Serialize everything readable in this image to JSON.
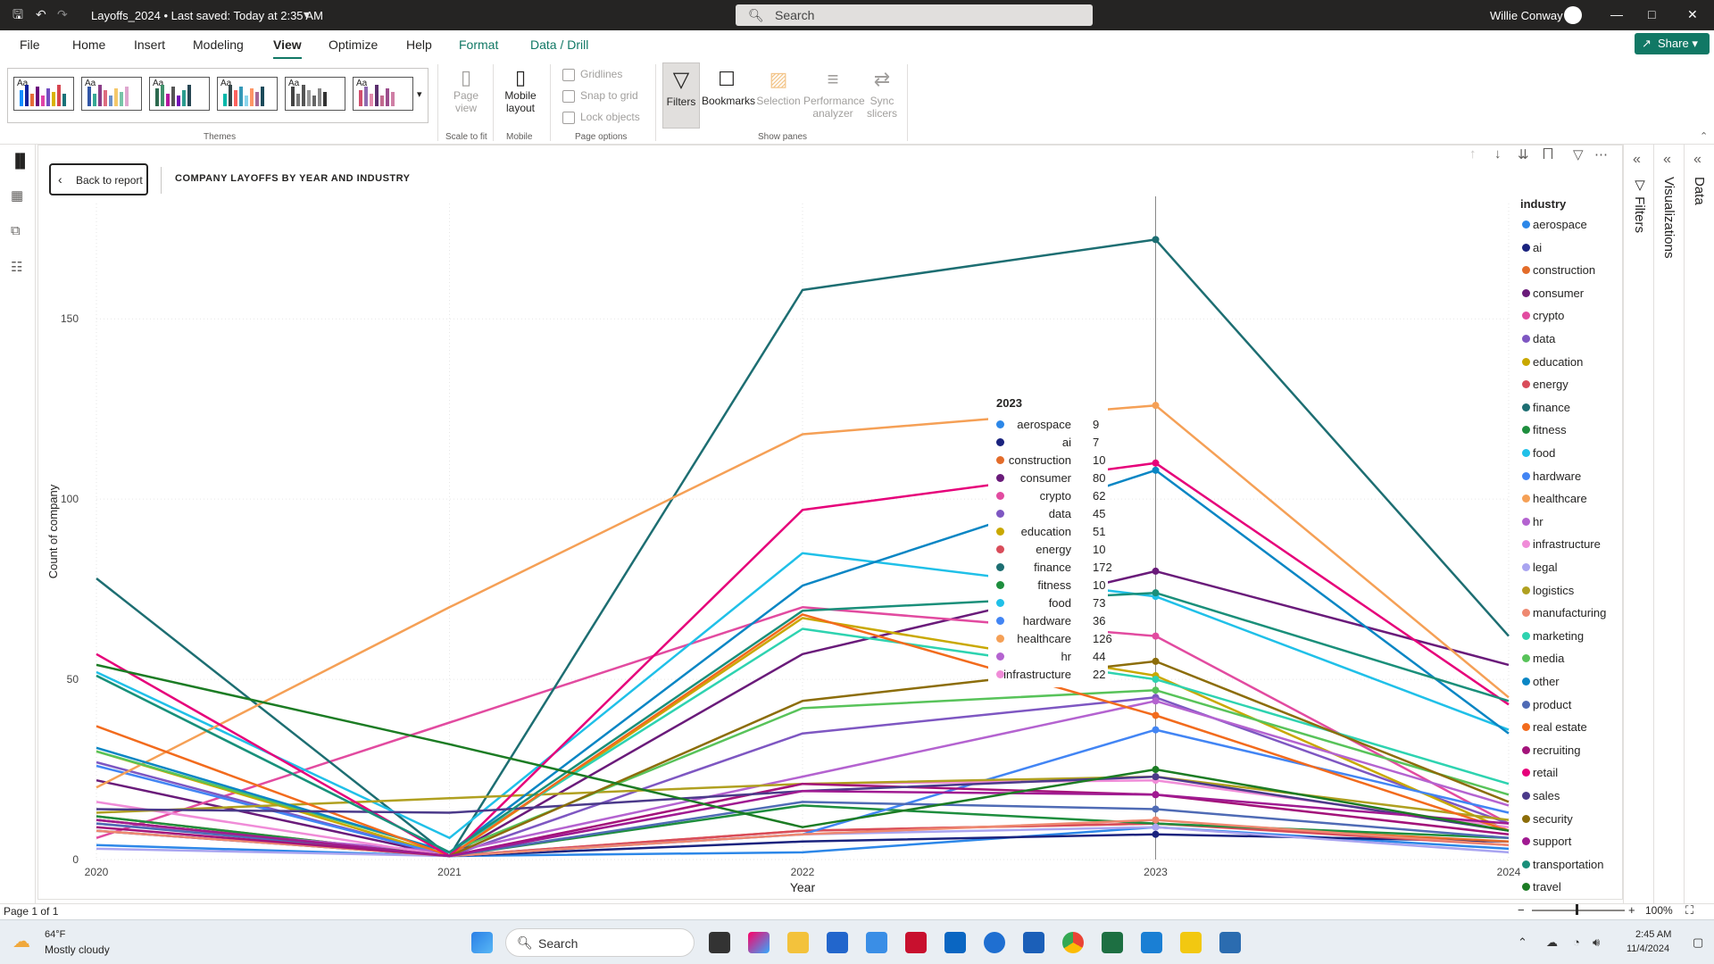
{
  "window": {
    "doc_title": "Layoffs_2024 • Last saved: Today at 2:35 AM",
    "search_placeholder": "Search",
    "user": "Willie Conway"
  },
  "menu": [
    "File",
    "Home",
    "Insert",
    "Modeling",
    "View",
    "Optimize",
    "Help",
    "Format",
    "Data / Drill"
  ],
  "active_menu": "View",
  "share_label": "Share",
  "ribbon": {
    "themes_label": "Themes",
    "page_view": "Page view",
    "scale_label": "Scale to fit",
    "mobile_layout": "Mobile layout",
    "mobile_label": "Mobile",
    "gridlines": "Gridlines",
    "snap": "Snap to grid",
    "lock": "Lock objects",
    "page_options_label": "Page options",
    "filters": "Filters",
    "bookmarks": "Bookmarks",
    "selection": "Selection",
    "performance": "Performance analyzer",
    "sync": "Sync slicers",
    "show_panes_label": "Show panes",
    "theme_aa": "Aa"
  },
  "report": {
    "back_label": "Back to report",
    "chart_title": "COMPANY LAYOFFS BY YEAR AND INDUSTRY",
    "legend_title": "industry"
  },
  "panes": {
    "filters": "Filters",
    "visualizations": "Visualizations",
    "data": "Data"
  },
  "status": {
    "page": "Page 1 of 1",
    "zoom": "100%"
  },
  "taskbar": {
    "temp": "64°F",
    "weather": "Mostly cloudy",
    "search": "Search",
    "time": "2:45 AM",
    "date": "11/4/2024"
  },
  "tooltip": {
    "title": "2023",
    "rows": [
      {
        "cat": "aerospace",
        "val": "9"
      },
      {
        "cat": "ai",
        "val": "7"
      },
      {
        "cat": "construction",
        "val": "10"
      },
      {
        "cat": "consumer",
        "val": "80"
      },
      {
        "cat": "crypto",
        "val": "62"
      },
      {
        "cat": "data",
        "val": "45"
      },
      {
        "cat": "education",
        "val": "51"
      },
      {
        "cat": "energy",
        "val": "10"
      },
      {
        "cat": "finance",
        "val": "172"
      },
      {
        "cat": "fitness",
        "val": "10"
      },
      {
        "cat": "food",
        "val": "73"
      },
      {
        "cat": "hardware",
        "val": "36"
      },
      {
        "cat": "healthcare",
        "val": "126"
      },
      {
        "cat": "hr",
        "val": "44"
      },
      {
        "cat": "infrastructure",
        "val": "22"
      }
    ]
  },
  "chart_data": {
    "type": "line",
    "title": "COMPANY LAYOFFS BY YEAR AND INDUSTRY",
    "xlabel": "Year",
    "ylabel": "Count of company",
    "x": [
      2020,
      2021,
      2022,
      2023,
      2024
    ],
    "yticks": [
      0,
      50,
      100,
      150
    ],
    "ylim": [
      0,
      182
    ],
    "legend_title": "industry",
    "legend_position": "right",
    "grid": true,
    "series": [
      {
        "name": "aerospace",
        "color": "#2C87E8",
        "values": [
          4,
          1,
          2,
          9,
          3
        ]
      },
      {
        "name": "ai",
        "color": "#1A237E",
        "values": [
          8,
          1,
          5,
          7,
          5
        ]
      },
      {
        "name": "construction",
        "color": "#E36C2A",
        "values": [
          12,
          1,
          8,
          10,
          5
        ]
      },
      {
        "name": "consumer",
        "color": "#6A1B7A",
        "values": [
          22,
          1,
          57,
          80,
          54
        ]
      },
      {
        "name": "crypto",
        "color": "#E24BA0",
        "values": [
          6,
          38,
          70,
          62,
          10
        ]
      },
      {
        "name": "data",
        "color": "#7E57C2",
        "values": [
          27,
          1,
          35,
          45,
          10
        ]
      },
      {
        "name": "education",
        "color": "#C9A800",
        "values": [
          30,
          1,
          67,
          51,
          8
        ]
      },
      {
        "name": "energy",
        "color": "#D94C5A",
        "values": [
          11,
          1,
          8,
          10,
          4
        ]
      },
      {
        "name": "finance",
        "color": "#1D6E72",
        "values": [
          78,
          1,
          158,
          172,
          62
        ]
      },
      {
        "name": "fitness",
        "color": "#1E8E3E",
        "values": [
          12,
          1,
          15,
          10,
          6
        ]
      },
      {
        "name": "food",
        "color": "#20C0E8",
        "values": [
          52,
          6,
          85,
          73,
          36
        ]
      },
      {
        "name": "hardware",
        "color": "#4285F4",
        "values": [
          26,
          1,
          7,
          36,
          13
        ]
      },
      {
        "name": "healthcare",
        "color": "#F5A056",
        "values": [
          20,
          70,
          118,
          126,
          45
        ]
      },
      {
        "name": "hr",
        "color": "#B463D0",
        "values": [
          10,
          2,
          23,
          44,
          15
        ]
      },
      {
        "name": "infrastructure",
        "color": "#F08CD8",
        "values": [
          16,
          1,
          21,
          22,
          9
        ]
      },
      {
        "name": "legal",
        "color": "#A9A4F0",
        "values": [
          3,
          1,
          7,
          9,
          2
        ]
      },
      {
        "name": "logistics",
        "color": "#B0A020",
        "values": [
          13,
          17,
          21,
          23,
          11
        ]
      },
      {
        "name": "manufacturing",
        "color": "#EE8870",
        "values": [
          8,
          1,
          7,
          11,
          4
        ]
      },
      {
        "name": "marketing",
        "color": "#2ED3B0",
        "values": [
          51,
          2,
          64,
          50,
          21
        ]
      },
      {
        "name": "media",
        "color": "#58C35A",
        "values": [
          30,
          2,
          42,
          47,
          18
        ]
      },
      {
        "name": "other",
        "color": "#0A86C4",
        "values": [
          31,
          2,
          76,
          108,
          35
        ]
      },
      {
        "name": "product",
        "color": "#4F6BB5",
        "values": [
          10,
          1,
          16,
          14,
          6
        ]
      },
      {
        "name": "real estate",
        "color": "#F26B1D",
        "values": [
          37,
          1,
          68,
          40,
          8
        ]
      },
      {
        "name": "recruiting",
        "color": "#A3137A",
        "values": [
          9,
          1,
          21,
          18,
          7
        ]
      },
      {
        "name": "retail",
        "color": "#E6007A",
        "values": [
          57,
          1,
          97,
          110,
          43
        ]
      },
      {
        "name": "sales",
        "color": "#4B3A8A",
        "values": [
          14,
          13,
          19,
          23,
          8
        ]
      },
      {
        "name": "security",
        "color": "#8C6D0A",
        "values": [
          11,
          1,
          44,
          55,
          16
        ]
      },
      {
        "name": "support",
        "color": "#A01A91",
        "values": [
          11,
          1,
          19,
          18,
          10
        ]
      },
      {
        "name": "transportation",
        "color": "#1A8F7A",
        "values": [
          51,
          2,
          69,
          74,
          44
        ]
      },
      {
        "name": "travel",
        "color": "#1C7C24",
        "values": [
          54,
          32,
          9,
          25,
          8
        ]
      }
    ]
  }
}
